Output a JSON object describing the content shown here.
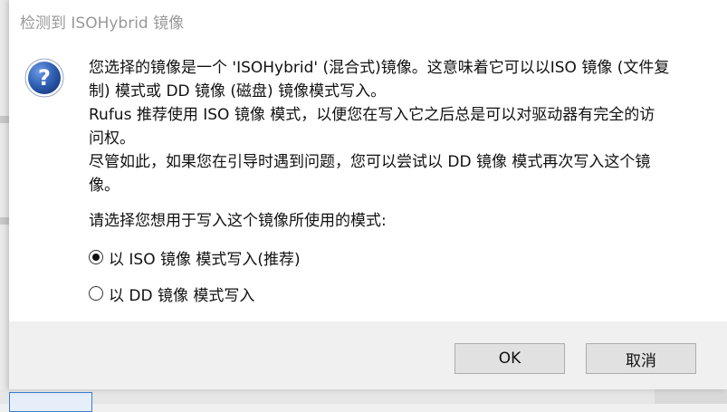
{
  "dialog": {
    "title": "检测到 ISOHybrid 镜像",
    "icon": "question-icon",
    "message_lines": [
      "您选择的镜像是一个 'ISOHybrid' (混合式)镜像。这意味着它可以以ISO 镜像 (文件复",
      "制) 模式或 DD 镜像 (磁盘) 镜像模式写入。",
      "Rufus 推荐使用 ISO 镜像 模式，以便您在写入它之后总是可以对驱动器有完全的访",
      "问权。",
      "尽管如此，如果您在引导时遇到问题，您可以尝试以 DD 镜像 模式再次写入这个镜",
      "像。"
    ],
    "prompt": "请选择您想用于写入这个镜像所使用的模式:",
    "options": [
      {
        "label": "以 ISO 镜像 模式写入(推荐)",
        "selected": true
      },
      {
        "label": "以 DD 镜像 模式写入",
        "selected": false
      }
    ],
    "buttons": {
      "ok": "OK",
      "cancel": "取消"
    }
  },
  "colors": {
    "icon_blue": "#2f5fb3",
    "title_text": "#999999",
    "footer_bg": "#f0f0f0",
    "button_bg": "#e1e1e1",
    "button_border": "#adadad"
  }
}
